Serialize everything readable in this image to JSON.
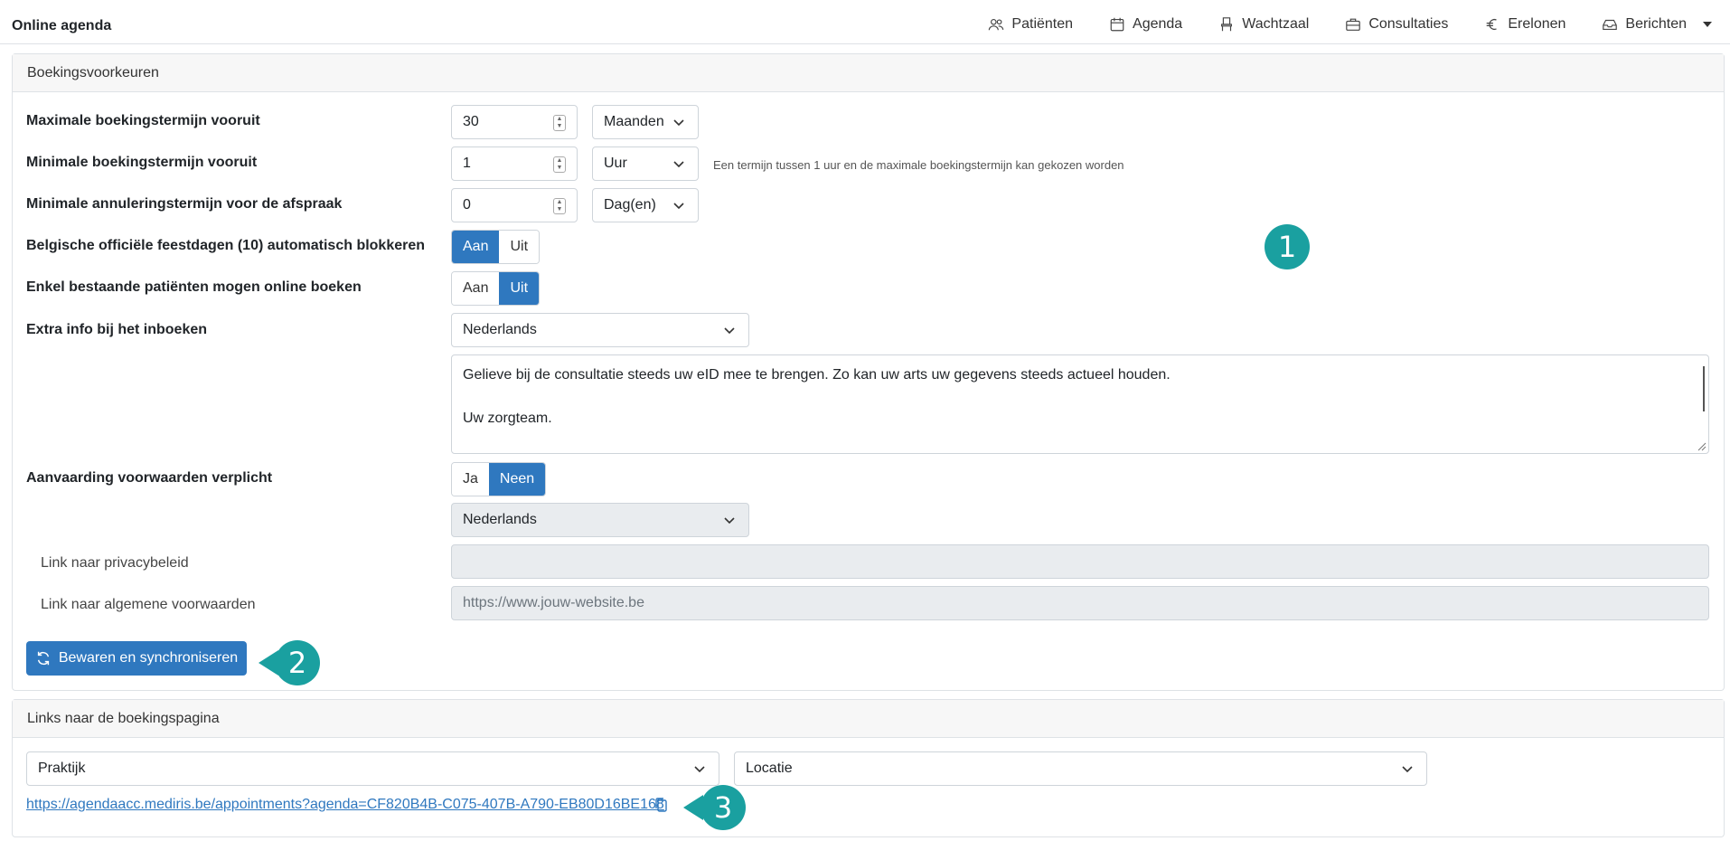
{
  "app": {
    "title": "Online agenda"
  },
  "nav": {
    "items": [
      {
        "label": "Patiënten",
        "icon": "users-icon"
      },
      {
        "label": "Agenda",
        "icon": "calendar-icon"
      },
      {
        "label": "Wachtzaal",
        "icon": "chair-icon"
      },
      {
        "label": "Consultaties",
        "icon": "briefcase-icon"
      },
      {
        "label": "Erelonen",
        "icon": "euro-icon"
      },
      {
        "label": "Berichten",
        "icon": "inbox-icon"
      }
    ]
  },
  "booking": {
    "header": "Boekingsvoorkeuren",
    "max_term": {
      "label": "Maximale boekingstermijn vooruit",
      "value": "30",
      "unit": "Maanden"
    },
    "min_term": {
      "label": "Minimale boekingstermijn vooruit",
      "value": "1",
      "unit": "Uur",
      "hint": "Een termijn tussen 1 uur en de maximale boekingstermijn kan gekozen worden"
    },
    "cancel_term": {
      "label": "Minimale annuleringstermijn voor de afspraak",
      "value": "0",
      "unit": "Dag(en)"
    },
    "holidays": {
      "label": "Belgische officiële feestdagen (10) automatisch blokkeren",
      "on": "Aan",
      "off": "Uit",
      "selected": "on"
    },
    "existing_only": {
      "label": "Enkel bestaande patiënten mogen online boeken",
      "on": "Aan",
      "off": "Uit",
      "selected": "off"
    },
    "extra_info": {
      "label": "Extra info bij het inboeken",
      "language": "Nederlands",
      "text_line1": "Gelieve bij de consultatie steeds uw eID mee te brengen. Zo kan uw arts uw gegevens steeds actueel houden.",
      "text_line2": "Uw zorgteam."
    },
    "terms": {
      "label": "Aanvaarding voorwaarden verplicht",
      "yes": "Ja",
      "no": "Neen",
      "selected": "no",
      "language": "Nederlands",
      "privacy_label": "Link naar privacybeleid",
      "privacy_value": "",
      "general_label": "Link naar algemene voorwaarden",
      "general_placeholder": "https://www.jouw-website.be"
    },
    "save_label": "Bewaren en synchroniseren"
  },
  "links": {
    "header": "Links naar de boekingspagina",
    "practice": "Praktijk",
    "location": "Locatie",
    "url": "https://agendaacc.mediris.be/appointments?agenda=CF820B4B-C075-407B-A790-EB80D16BE168"
  },
  "callouts": {
    "one": "1",
    "two": "2",
    "three": "3"
  },
  "colors": {
    "primary": "#2f78bf",
    "callout": "#1aa0a0"
  }
}
